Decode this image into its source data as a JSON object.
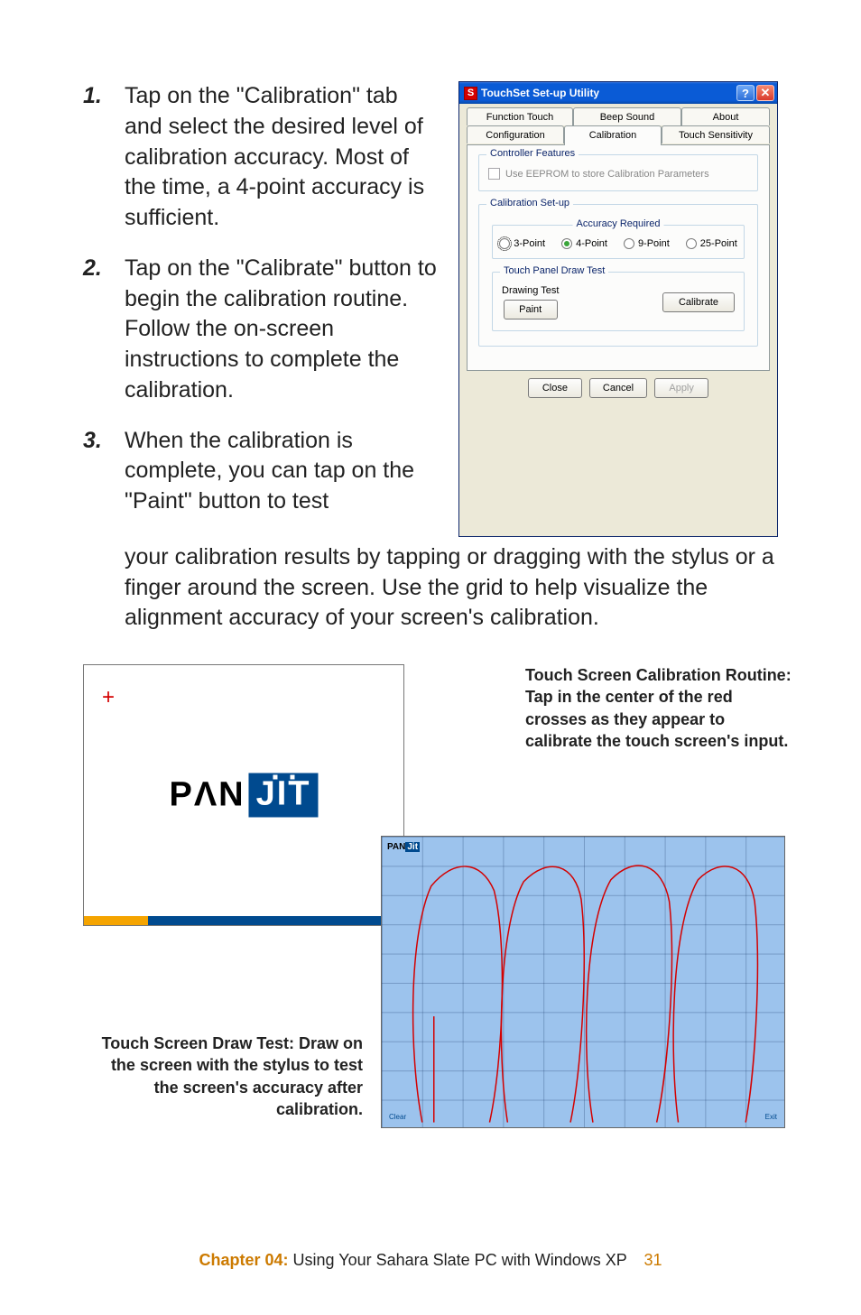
{
  "steps": [
    {
      "num": "1.",
      "text_a": "Tap on the \"Calibration\" tab and select the desired level of calibration accuracy. Most of the time, a 4-point accuracy is sufficient."
    },
    {
      "num": "2.",
      "text_a": "Tap on the \"Calibrate\" button to begin the calibration routine. Follow the on-screen instructions to complete the calibration."
    },
    {
      "num": "3.",
      "text_a": "When the calibration is complete, you can tap on the \"Paint\" button to test"
    }
  ],
  "continuation": "your calibration results by tapping or dragging with the stylus or a finger around the screen. Use the grid to help visualize the alignment accuracy of your screen's calibration.",
  "dialog": {
    "title": "TouchSet Set-up Utility",
    "tabs": {
      "function_touch": "Function Touch",
      "beep_sound": "Beep Sound",
      "about": "About",
      "configuration": "Configuration",
      "calibration": "Calibration",
      "touch_sensitivity": "Touch Sensitivity"
    },
    "controller_features": {
      "legend": "Controller Features",
      "checkbox": "Use EEPROM to store Calibration Parameters"
    },
    "calibration_setup": {
      "legend": "Calibration Set-up",
      "accuracy_legend": "Accuracy Required",
      "options": {
        "p3": "3-Point",
        "p4": "4-Point",
        "p9": "9-Point",
        "p25": "25-Point"
      }
    },
    "draw_test": {
      "legend": "Touch Panel Draw Test",
      "subtitle": "Drawing Test",
      "paint": "Paint",
      "calibrate": "Calibrate"
    },
    "buttons": {
      "close": "Close",
      "cancel": "Cancel",
      "apply": "Apply"
    }
  },
  "captions": {
    "right": "Touch Screen Calibration Routine: Tap in the center of the red crosses as they appear to calibrate the touch screen's input.",
    "left": "Touch Screen Draw Test: Draw on the screen with the stylus to test the screen's accuracy after calibration."
  },
  "panjit": {
    "cross": "+",
    "pan": "PΛN",
    "jit": "JIT"
  },
  "drawbox": {
    "mini_pan": "PAN",
    "mini_jit": "Jit",
    "clear": "Clear",
    "exit": "Exit"
  },
  "footer": {
    "chapter": "Chapter 04:",
    "title": " Using Your Sahara Slate PC with Windows XP",
    "page": "31"
  }
}
